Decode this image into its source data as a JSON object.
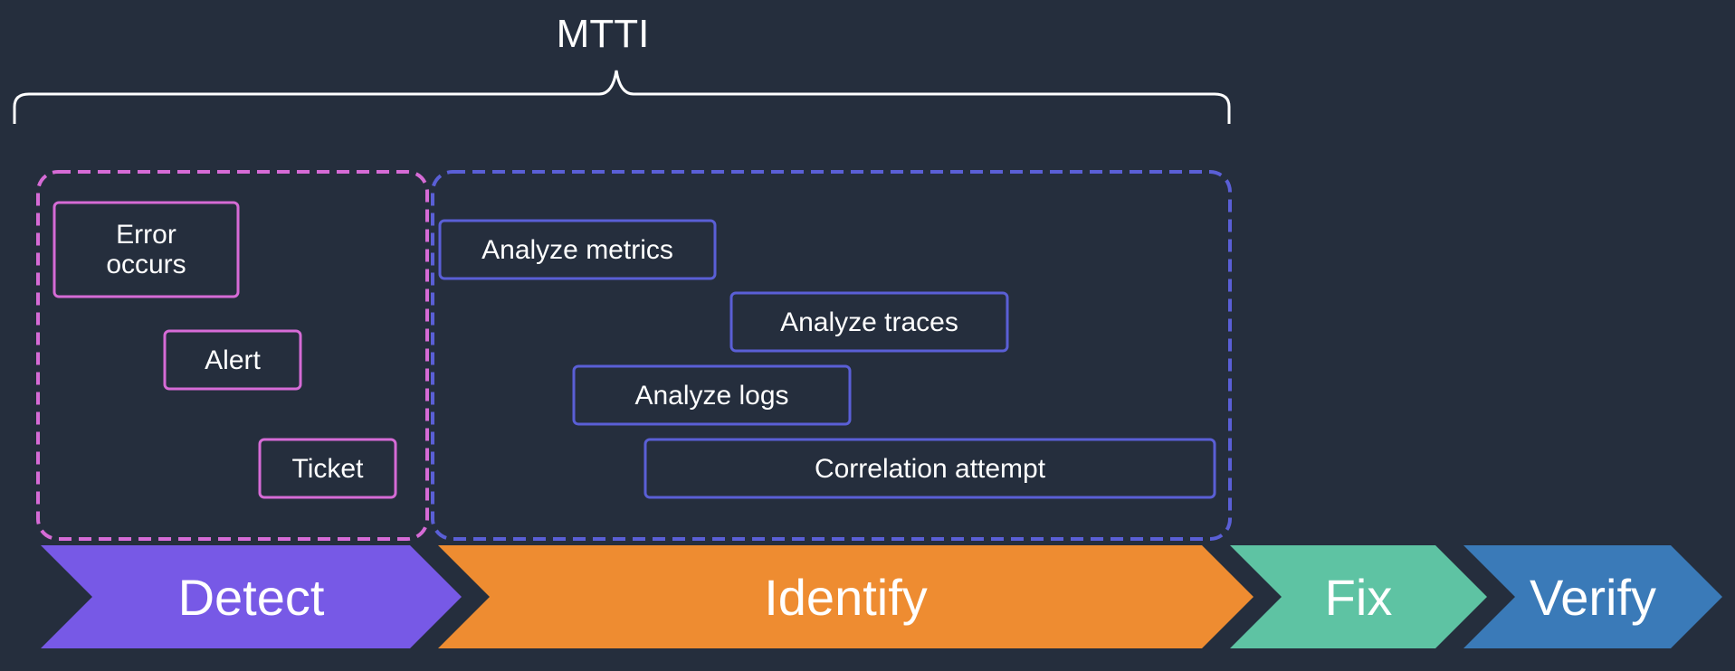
{
  "title": "MTTI",
  "detect_group": {
    "color": "#d66bd6",
    "boxes": [
      {
        "label": "Error\noccurs"
      },
      {
        "label": "Alert"
      },
      {
        "label": "Ticket"
      }
    ]
  },
  "identify_group": {
    "color": "#5a5fd6",
    "boxes": [
      {
        "label": "Analyze metrics"
      },
      {
        "label": "Analyze traces"
      },
      {
        "label": "Analyze logs"
      },
      {
        "label": "Correlation attempt"
      }
    ]
  },
  "phases": [
    {
      "label": "Detect",
      "color": "#7759e6"
    },
    {
      "label": "Identify",
      "color": "#ee8c31"
    },
    {
      "label": "Fix",
      "color": "#5ec3a3"
    },
    {
      "label": "Verify",
      "color": "#3a7ab8"
    }
  ]
}
